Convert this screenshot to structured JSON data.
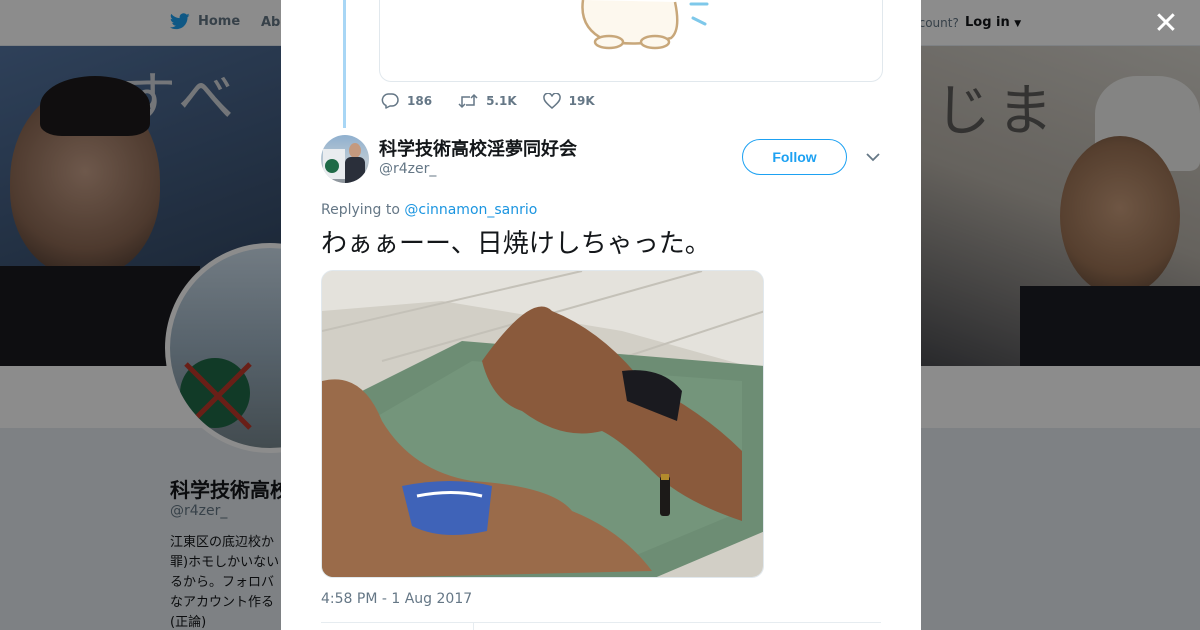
{
  "topnav": {
    "home_label": "Home",
    "about_label": "Abo",
    "account_label": "ccount?",
    "login_label": "Log in"
  },
  "banner": {
    "sign_left": "すべ",
    "sign_right": "じま"
  },
  "profile": {
    "name": "科学技術高校",
    "handle": "@r4zer_",
    "bio": "江東区の底辺校か\n罪)ホモしかいない\nるから。フォロバ\nなアカウント作る\n(正論)"
  },
  "modal": {
    "close_icon": "close-icon",
    "parent_stats": {
      "replies": "186",
      "retweets": "5.1K",
      "likes": "19K"
    },
    "tweet": {
      "author_name": "科学技術高校淫夢同好会",
      "author_handle": "@r4zer_",
      "follow_label": "Follow",
      "replying_prefix": "Replying to ",
      "replying_to": "@cinnamon_sanrio",
      "text": "わぁぁーー、日焼けしちゃった。",
      "timestamp": "4:58 PM - 1 Aug 2017"
    }
  },
  "colors": {
    "twitter_blue": "#1da1f2",
    "link_blue": "#1b95e0",
    "text_primary": "#14171a",
    "text_secondary": "#657786",
    "thread_line": "#a8d6f5"
  }
}
